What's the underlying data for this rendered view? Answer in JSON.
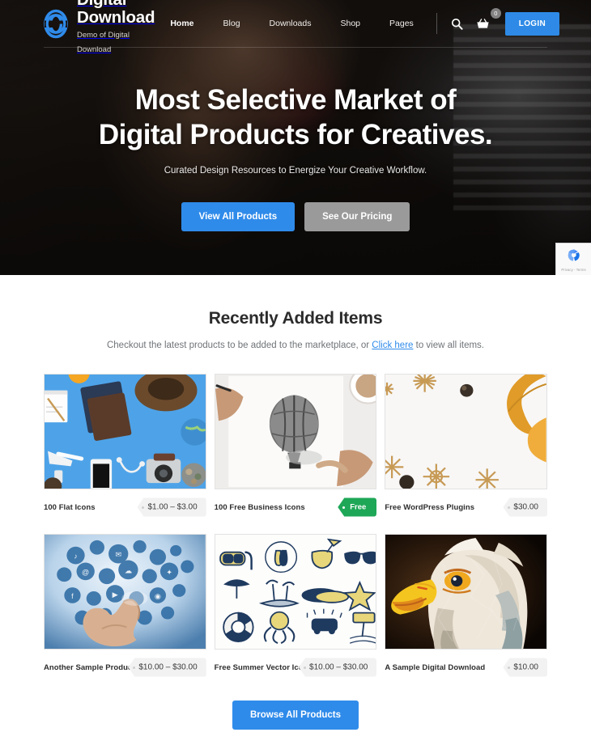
{
  "brand": {
    "title": "Digital Download",
    "subtitle": "Demo of Digital Download",
    "logo_icon": "fingerprint-logo-icon",
    "accent_color": "#2f8bea"
  },
  "nav": {
    "links": [
      {
        "label": "Home",
        "active": true
      },
      {
        "label": "Blog",
        "active": false
      },
      {
        "label": "Downloads",
        "active": false
      },
      {
        "label": "Shop",
        "active": false
      },
      {
        "label": "Pages",
        "active": false
      }
    ],
    "search_icon": "search-icon",
    "cart_icon": "shopping-basket-icon",
    "cart_count": "0",
    "login_label": "LOGIN"
  },
  "hero": {
    "title_line1": "Most Selective Market of",
    "title_line2": "Digital Products for Creatives.",
    "subtitle": "Curated Design Resources to Energize Your Creative Workflow.",
    "primary_button": "View All Products",
    "secondary_button": "See Our Pricing"
  },
  "recaptcha": {
    "icon": "recaptcha-icon",
    "text": "Privacy - Terms"
  },
  "products_section": {
    "title": "Recently Added Items",
    "subtitle_before": "Checkout the latest products to be added to the marketplace, or ",
    "subtitle_link": "Click here",
    "subtitle_after": " to view all items.",
    "browse_button": "Browse All Products",
    "items": [
      {
        "title": "100 Flat Icons",
        "price": "$1.00 – $3.00",
        "free": false,
        "art": "art-flat"
      },
      {
        "title": "100 Free Business Icons",
        "price": "Free",
        "free": true,
        "art": "art-balloon"
      },
      {
        "title": "Free WordPress Plugins",
        "price": "$30.00",
        "free": false,
        "art": "art-snow"
      },
      {
        "title": "Another Sample Product",
        "price": "$10.00 – $30.00",
        "free": false,
        "art": "art-tech"
      },
      {
        "title": "Free Summer Vector Icons",
        "price": "$10.00 – $30.00",
        "free": false,
        "art": "art-summer"
      },
      {
        "title": "A Sample Digital Download",
        "price": "$10.00",
        "free": false,
        "art": "art-eagle"
      }
    ]
  }
}
